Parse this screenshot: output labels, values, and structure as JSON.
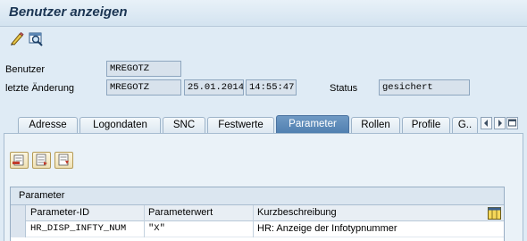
{
  "window": {
    "title": "Benutzer anzeigen"
  },
  "toolbar": {
    "icons": [
      "display-change-icon",
      "find-icon"
    ]
  },
  "header_fields": {
    "benutzer_label": "Benutzer",
    "benutzer_value": "MREGOTZ",
    "letzte_aenderung_label": "letzte Änderung",
    "letzte_aenderung_user": "MREGOTZ",
    "letzte_aenderung_date": "25.01.2014",
    "letzte_aenderung_time": "14:55:47",
    "status_label": "Status",
    "status_value": "gesichert"
  },
  "tabs": [
    {
      "label": "Adresse",
      "active": false
    },
    {
      "label": "Logondaten",
      "active": false
    },
    {
      "label": "SNC",
      "active": false
    },
    {
      "label": "Festwerte",
      "active": false
    },
    {
      "label": "Parameter",
      "active": true
    },
    {
      "label": "Rollen",
      "active": false
    },
    {
      "label": "Profile",
      "active": false
    },
    {
      "label": "G..",
      "active": false
    }
  ],
  "panel_buttons": [
    "insert-row-icon",
    "append-row-icon",
    "delete-row-icon"
  ],
  "grid": {
    "title": "Parameter",
    "columns": [
      "Parameter-ID",
      "Parameterwert",
      "Kurzbeschreibung"
    ],
    "rows": [
      {
        "id": "HR_DISP_INFTY_NUM",
        "value": "\"X\"",
        "desc": "HR: Anzeige der Infotypnummer"
      }
    ]
  },
  "colors": {
    "active_tab": "#5a88b8",
    "background": "#dfebf5",
    "title_text": "#1b3553"
  }
}
